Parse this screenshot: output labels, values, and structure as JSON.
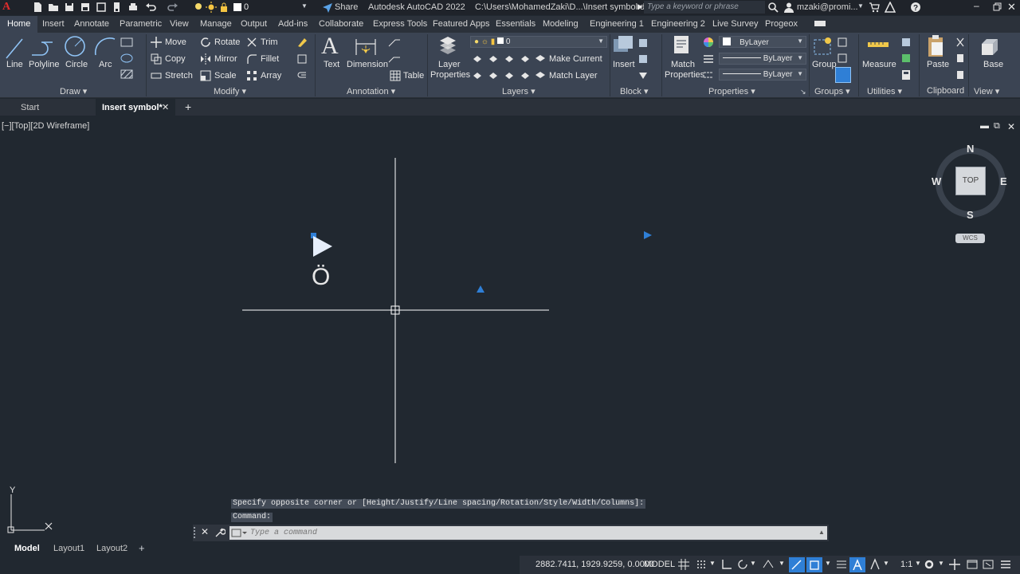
{
  "titlebar": {
    "app_letter": "A",
    "layer_value": "0",
    "share_label": "Share",
    "title": "Autodesk AutoCAD 2022",
    "path": "C:\\Users\\MohamedZaki\\D...\\Insert symbol.dwg",
    "search_placeholder": "Type a keyword or phrase",
    "user": "mzaki@promi..."
  },
  "ribbon_tabs": [
    "Home",
    "Insert",
    "Annotate",
    "Parametric",
    "View",
    "Manage",
    "Output",
    "Add-ins",
    "Collaborate",
    "Express Tools",
    "Featured Apps",
    "Essentials",
    "Modeling",
    "Engineering 1",
    "Engineering 2",
    "Live Survey",
    "Progeox"
  ],
  "ribbon": {
    "draw": {
      "title": "Draw",
      "line": "Line",
      "polyline": "Polyline",
      "circle": "Circle",
      "arc": "Arc"
    },
    "modify": {
      "title": "Modify",
      "move": "Move",
      "rotate": "Rotate",
      "trim": "Trim",
      "copy": "Copy",
      "mirror": "Mirror",
      "fillet": "Fillet",
      "stretch": "Stretch",
      "scale": "Scale",
      "array": "Array"
    },
    "annotation": {
      "title": "Annotation",
      "text": "Text",
      "dimension": "Dimension",
      "table": "Table"
    },
    "layers": {
      "title": "Layers",
      "layer_properties_1": "Layer",
      "layer_properties_2": "Properties",
      "current_layer": "0",
      "make_current": "Make Current",
      "match_layer": "Match Layer"
    },
    "block": {
      "title": "Block",
      "insert": "Insert"
    },
    "properties": {
      "title": "Properties",
      "match_1": "Match",
      "match_2": "Properties",
      "color": "ByLayer",
      "linetype": "ByLayer",
      "lineweight": "ByLayer"
    },
    "groups": {
      "title": "Groups",
      "group": "Group"
    },
    "utilities": {
      "title": "Utilities",
      "measure": "Measure"
    },
    "clipboard": {
      "title": "Clipboard",
      "paste": "Paste"
    },
    "view": {
      "title": "View",
      "base": "Base"
    }
  },
  "file_tabs": {
    "start": "Start",
    "active": "Insert symbol*"
  },
  "viewport": {
    "label": "[−][Top][2D Wireframe]",
    "viewcube": {
      "n": "N",
      "s": "S",
      "e": "E",
      "w": "W",
      "top": "TOP",
      "wcs": "WCS"
    },
    "drawing_text": "Ö",
    "ucs_y": "Y"
  },
  "command": {
    "history_1": "Specify opposite corner or [Height/Justify/Line spacing/Rotation/Style/Width/Columns]:",
    "history_2": "Command:",
    "placeholder": "Type a command"
  },
  "layout_tabs": [
    "Model",
    "Layout1",
    "Layout2"
  ],
  "status": {
    "coords": "2882.7411, 1929.9259, 0.0000",
    "space": "MODEL",
    "scale": "1:1"
  },
  "colors": {
    "accent": "#2f7fd6",
    "background": "#212830",
    "ribbon": "#3b4453"
  }
}
